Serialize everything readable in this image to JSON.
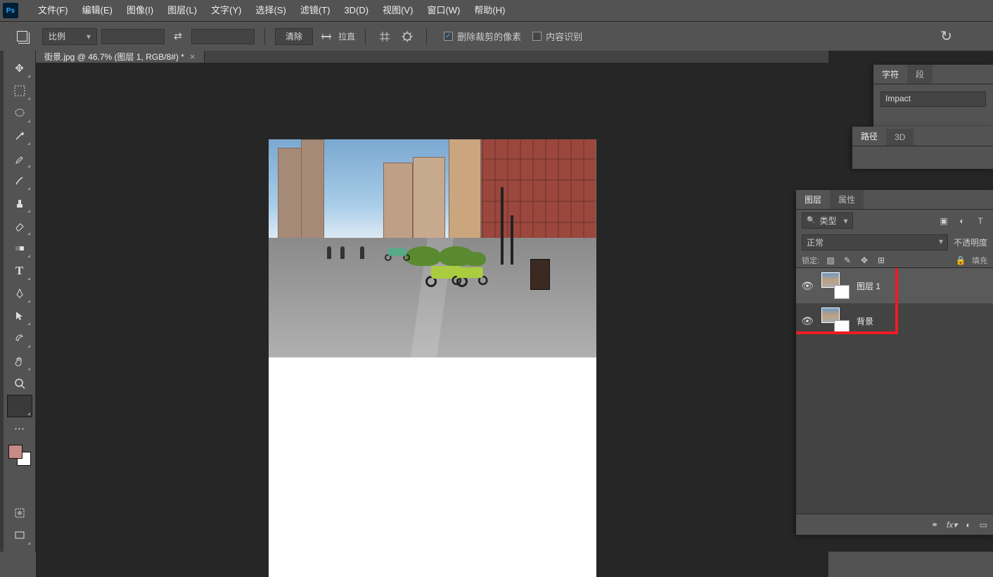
{
  "menu": {
    "file": "文件(F)",
    "edit": "编辑(E)",
    "image": "图像(I)",
    "layer": "图层(L)",
    "type": "文字(Y)",
    "select": "选择(S)",
    "filter": "滤镜(T)",
    "threeD": "3D(D)",
    "view": "视图(V)",
    "window": "窗口(W)",
    "help": "帮助(H)"
  },
  "optbar": {
    "ratio_mode": "比例",
    "clear": "清除",
    "straighten": "拉直",
    "delete_pixels": "删除裁剪的像素",
    "content_aware": "内容识别"
  },
  "document": {
    "tab_title": "街景.jpg @ 46.7% (图层 1, RGB/8#) *"
  },
  "char_panel": {
    "tab_char": "字符",
    "tab_para": "段",
    "font": "Impact"
  },
  "path_panel": {
    "tab_path": "路径",
    "tab_3d": "3D"
  },
  "layer_panel": {
    "tab_layer": "图层",
    "tab_props": "属性",
    "filter_kind": "类型",
    "blend_mode": "正常",
    "opacity_label": "不透明度",
    "lock_label": "锁定:",
    "fill_label": "填充",
    "layers": [
      {
        "name": "图层 1",
        "visible": true
      },
      {
        "name": "背景",
        "visible": true
      }
    ]
  }
}
